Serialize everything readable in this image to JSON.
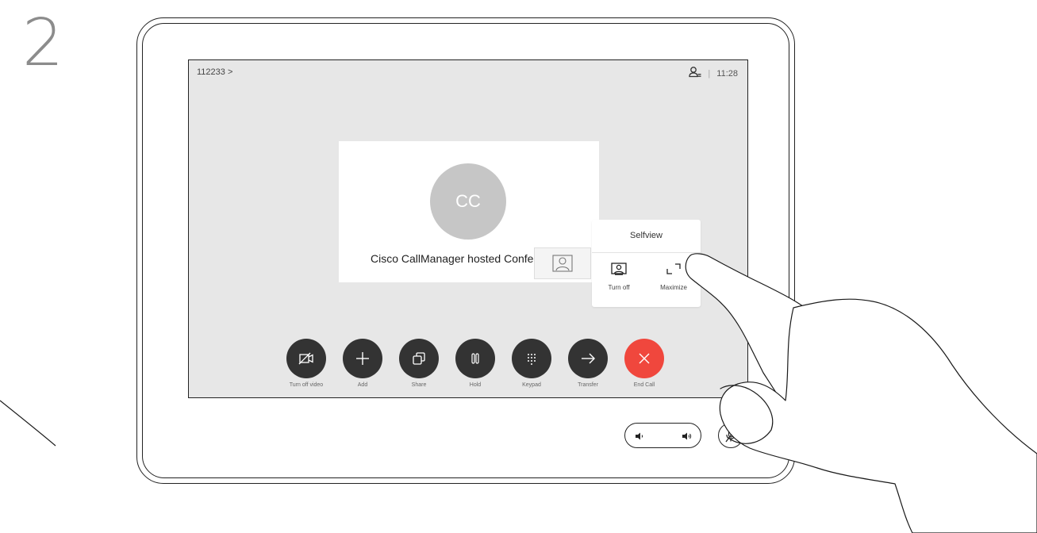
{
  "step_number": "2",
  "header": {
    "call_id": "112233 >",
    "time": "11:28",
    "separator": "|"
  },
  "participant": {
    "initials": "CC",
    "name": "Cisco CallManager hosted Confe"
  },
  "selfview_menu": {
    "title": "Selfview",
    "options": [
      {
        "label": "Turn off",
        "icon": "selfview-icon"
      },
      {
        "label": "Maximize",
        "icon": "maximize-icon"
      }
    ]
  },
  "controls": [
    {
      "label": "Turn off video",
      "icon": "video-off-icon",
      "color": "#333333"
    },
    {
      "label": "Add",
      "icon": "plus-icon",
      "color": "#333333"
    },
    {
      "label": "Share",
      "icon": "share-icon",
      "color": "#333333"
    },
    {
      "label": "Hold",
      "icon": "pause-icon",
      "color": "#333333"
    },
    {
      "label": "Keypad",
      "icon": "keypad-icon",
      "color": "#333333"
    },
    {
      "label": "Transfer",
      "icon": "arrow-right-icon",
      "color": "#333333"
    },
    {
      "label": "End Call",
      "icon": "close-icon",
      "color": "#f0473d"
    }
  ],
  "hardware": {
    "volume_down_icon": "volume-down-icon",
    "volume_up_icon": "volume-up-icon",
    "mute_icon": "microphone-mute-icon"
  }
}
